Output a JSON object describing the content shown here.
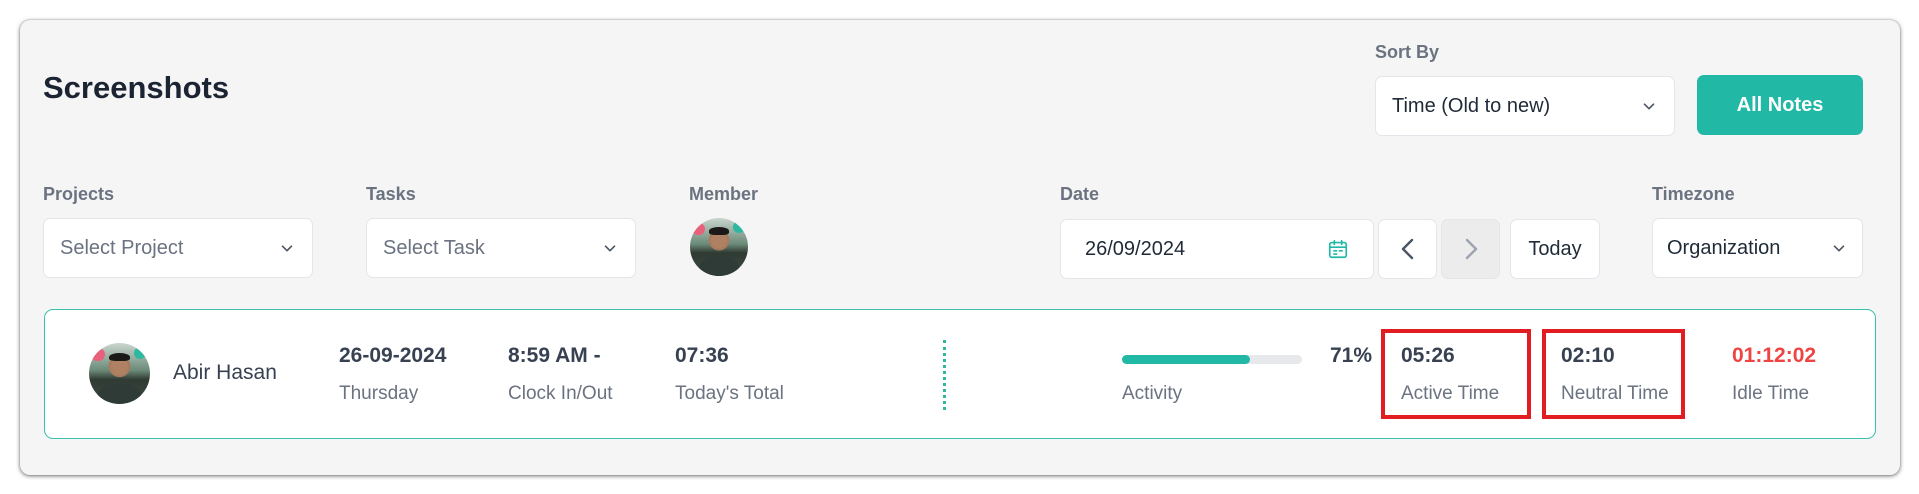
{
  "page": {
    "title": "Screenshots"
  },
  "sort": {
    "label": "Sort By",
    "value": "Time (Old to new)"
  },
  "all_notes_button": "All Notes",
  "filters": {
    "projects": {
      "label": "Projects",
      "placeholder": "Select Project"
    },
    "tasks": {
      "label": "Tasks",
      "placeholder": "Select Task"
    },
    "member": {
      "label": "Member"
    },
    "date": {
      "label": "Date",
      "value": "26/09/2024",
      "today_label": "Today"
    },
    "timezone": {
      "label": "Timezone",
      "value": "Organization"
    }
  },
  "summary": {
    "member_name": "Abir Hasan",
    "date": "26-09-2024",
    "weekday": "Thursday",
    "clock_in_out": "8:59 AM -",
    "clock_in_out_label": "Clock In/Out",
    "today_total": "07:36",
    "today_total_label": "Today's Total",
    "activity_label": "Activity",
    "activity_percent_text": "71%",
    "activity_percent": 71,
    "active_time": "05:26",
    "active_time_label": "Active Time",
    "neutral_time": "02:10",
    "neutral_time_label": "Neutral Time",
    "idle_time": "01:12:02",
    "idle_time_label": "Idle Time"
  },
  "colors": {
    "accent": "#22b8a6",
    "idle": "#ef4444",
    "highlight": "#e11d22"
  }
}
